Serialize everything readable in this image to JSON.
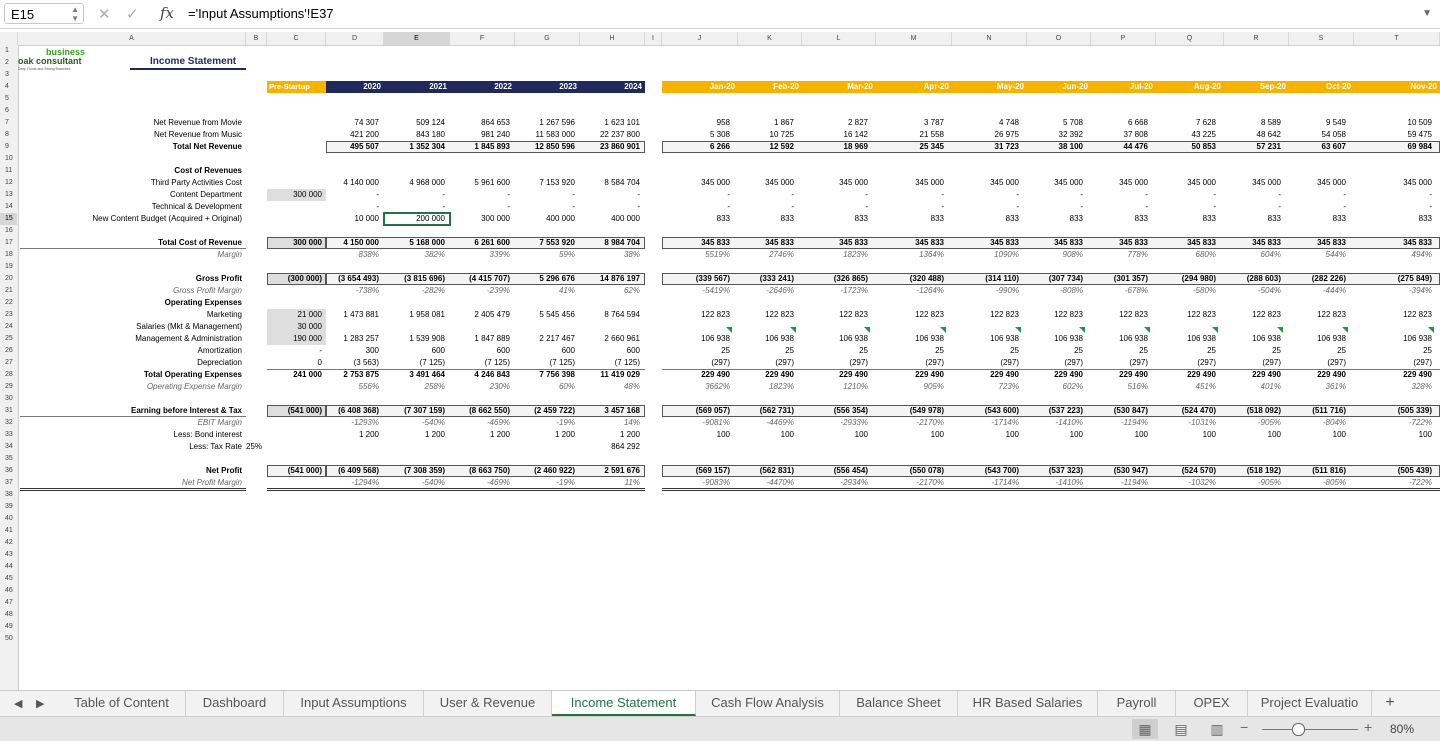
{
  "formula_bar": {
    "cell_ref": "E15",
    "formula": "='Input Assumptions'!E37",
    "fx": "fx"
  },
  "columns": [
    "A",
    "B",
    "C",
    "D",
    "E",
    "F",
    "G",
    "H",
    "I",
    "J",
    "K",
    "L",
    "M",
    "N",
    "O",
    "P",
    "Q",
    "R",
    "S",
    "T"
  ],
  "selected_column": "E",
  "selected_row": "15",
  "rows": [
    "1",
    "2",
    "3",
    "4",
    "5",
    "6",
    "7",
    "8",
    "9",
    "10",
    "11",
    "12",
    "13",
    "14",
    "15",
    "16",
    "17",
    "18",
    "19",
    "20",
    "21",
    "22",
    "23",
    "24",
    "25",
    "26",
    "27",
    "28",
    "29",
    "30",
    "31",
    "32",
    "33",
    "34",
    "35",
    "36",
    "37",
    "38",
    "39",
    "40",
    "41",
    "42",
    "43",
    "44",
    "45",
    "46",
    "47",
    "48",
    "49",
    "50"
  ],
  "logo": {
    "text_top": "business",
    "text_mid": "oak consultant",
    "tagline": "Deep Roots and Strong Branches"
  },
  "title": "Income Statement",
  "header": {
    "pre": "Pre-Startup",
    "years": [
      "2020",
      "2021",
      "2022",
      "2023",
      "2024"
    ],
    "months": [
      "Jan-20",
      "Feb-20",
      "Mar-20",
      "Apr-20",
      "May-20",
      "Jun-20",
      "Jul-20",
      "Aug-20",
      "Sep-20",
      "Oct-20",
      "Nov-20"
    ]
  },
  "lines": [
    {
      "row": 7,
      "label": "Net Revenue from Movie",
      "pre": "",
      "years": [
        "74 307",
        "509 124",
        "864 653",
        "1 267 596",
        "1 623 101"
      ],
      "months": [
        "958",
        "1 867",
        "2 827",
        "3 787",
        "4 748",
        "5 708",
        "6 668",
        "7 628",
        "8 589",
        "9 549",
        "10 509"
      ]
    },
    {
      "row": 8,
      "label": "Net Revenue from Music",
      "pre": "",
      "years": [
        "421 200",
        "843 180",
        "981 240",
        "11 583 000",
        "22 237 800"
      ],
      "months": [
        "5 308",
        "10 725",
        "16 142",
        "21 558",
        "26 975",
        "32 392",
        "37 808",
        "43 225",
        "48 642",
        "54 058",
        "59 475"
      ]
    },
    {
      "row": 9,
      "label": "Total Net Revenue",
      "bold": true,
      "box": true,
      "pre": "",
      "years": [
        "495 507",
        "1 352 304",
        "1 845 893",
        "12 850 596",
        "23 860 901"
      ],
      "months": [
        "6 266",
        "12 592",
        "18 969",
        "25 345",
        "31 723",
        "38 100",
        "44 476",
        "50 853",
        "57 231",
        "63 607",
        "69 984"
      ]
    },
    {
      "row": 11,
      "label": "Cost of Revenues",
      "bold": true,
      "pre": "",
      "years": [
        "",
        "",
        "",
        "",
        ""
      ],
      "months": [
        "",
        "",
        "",
        "",
        "",
        "",
        "",
        "",
        "",
        "",
        ""
      ]
    },
    {
      "row": 12,
      "label": "Third Party Activities Cost",
      "pre": "",
      "years": [
        "4 140 000",
        "4 968 000",
        "5 961 600",
        "7 153 920",
        "8 584 704"
      ],
      "months": [
        "345 000",
        "345 000",
        "345 000",
        "345 000",
        "345 000",
        "345 000",
        "345 000",
        "345 000",
        "345 000",
        "345 000",
        "345 000"
      ]
    },
    {
      "row": 13,
      "label": "Content Department",
      "pre": "300 000",
      "preshade": true,
      "years": [
        "-",
        "-",
        "-",
        "-",
        "-"
      ],
      "months": [
        "-",
        "-",
        "-",
        "-",
        "-",
        "-",
        "-",
        "-",
        "-",
        "-",
        "-"
      ]
    },
    {
      "row": 14,
      "label": "Technical & Development",
      "pre": "",
      "years": [
        "-",
        "-",
        "-",
        "-",
        "-"
      ],
      "months": [
        "-",
        "-",
        "-",
        "-",
        "-",
        "-",
        "-",
        "-",
        "-",
        "-",
        "-"
      ]
    },
    {
      "row": 15,
      "label": "New Content Budget (Acquired + Original)",
      "pre": "",
      "years": [
        "10 000",
        "200 000",
        "300 000",
        "400 000",
        "400 000"
      ],
      "months": [
        "833",
        "833",
        "833",
        "833",
        "833",
        "833",
        "833",
        "833",
        "833",
        "833",
        "833"
      ]
    },
    {
      "row": 17,
      "label": "Total Cost of Revenue",
      "bold": true,
      "box": true,
      "pre": "300 000",
      "preshade": true,
      "years": [
        "4 150 000",
        "5 168 000",
        "6 261 600",
        "7 553 920",
        "8 984 704"
      ],
      "months": [
        "345 833",
        "345 833",
        "345 833",
        "345 833",
        "345 833",
        "345 833",
        "345 833",
        "345 833",
        "345 833",
        "345 833",
        "345 833"
      ]
    },
    {
      "row": 18,
      "label": "Margin",
      "italic": true,
      "pre": "",
      "years": [
        "838%",
        "382%",
        "339%",
        "59%",
        "38%"
      ],
      "months": [
        "5519%",
        "2746%",
        "1823%",
        "1364%",
        "1090%",
        "908%",
        "778%",
        "680%",
        "604%",
        "544%",
        "494%"
      ]
    },
    {
      "row": 20,
      "label": "Gross Profit",
      "bold": true,
      "box": true,
      "pre": "(300 000)",
      "preshade": true,
      "years": [
        "(3 654 493)",
        "(3 815 696)",
        "(4 415 707)",
        "5 296 676",
        "14 876 197"
      ],
      "months": [
        "(339 567)",
        "(333 241)",
        "(326 865)",
        "(320 488)",
        "(314 110)",
        "(307 734)",
        "(301 357)",
        "(294 980)",
        "(288 603)",
        "(282 226)",
        "(275 849)"
      ]
    },
    {
      "row": 21,
      "label": "Gross Profit Margin",
      "italic": true,
      "pre": "",
      "years": [
        "-738%",
        "-282%",
        "-239%",
        "41%",
        "62%"
      ],
      "months": [
        "-5419%",
        "-2646%",
        "-1723%",
        "-1264%",
        "-990%",
        "-808%",
        "-678%",
        "-580%",
        "-504%",
        "-444%",
        "-394%"
      ]
    },
    {
      "row": 22,
      "label": "Operating Expenses",
      "bold": true,
      "pre": "",
      "years": [
        "",
        "",
        "",
        "",
        ""
      ],
      "months": [
        "",
        "",
        "",
        "",
        "",
        "",
        "",
        "",
        "",
        "",
        ""
      ]
    },
    {
      "row": 23,
      "label": "Marketing",
      "pre": "21 000",
      "preshade": true,
      "years": [
        "1 473 881",
        "1 958 081",
        "2 405 479",
        "5 545 456",
        "8 764 594"
      ],
      "months": [
        "122 823",
        "122 823",
        "122 823",
        "122 823",
        "122 823",
        "122 823",
        "122 823",
        "122 823",
        "122 823",
        "122 823",
        "122 823"
      ]
    },
    {
      "row": 24,
      "label": "Salaries (Mkt & Management)",
      "pre": "30 000",
      "preshade": true,
      "years": [
        "",
        "",
        "",
        "",
        ""
      ],
      "months": [
        "",
        "",
        "",
        "",
        "",
        "",
        "",
        "",
        "",
        "",
        ""
      ]
    },
    {
      "row": 25,
      "label": "Management & Administration",
      "pre": "190 000",
      "preshade": true,
      "tri": true,
      "years": [
        "1 283 257",
        "1 539 908",
        "1 847 889",
        "2 217 467",
        "2 660 961"
      ],
      "months": [
        "106 938",
        "106 938",
        "106 938",
        "106 938",
        "106 938",
        "106 938",
        "106 938",
        "106 938",
        "106 938",
        "106 938",
        "106 938"
      ]
    },
    {
      "row": 26,
      "label": "Amortization",
      "pre": "-",
      "years": [
        "300",
        "600",
        "600",
        "600",
        "600"
      ],
      "months": [
        "25",
        "25",
        "25",
        "25",
        "25",
        "25",
        "25",
        "25",
        "25",
        "25",
        "25"
      ]
    },
    {
      "row": 27,
      "label": "Depreciation",
      "pre": "0",
      "years": [
        "(3 563)",
        "(7 125)",
        "(7 125)",
        "(7 125)",
        "(7 125)"
      ],
      "months": [
        "(297)",
        "(297)",
        "(297)",
        "(297)",
        "(297)",
        "(297)",
        "(297)",
        "(297)",
        "(297)",
        "(297)",
        "(297)"
      ]
    },
    {
      "row": 28,
      "label": "Total Operating Expenses",
      "bold": true,
      "pre": "241 000",
      "years": [
        "2 753 875",
        "3 491 464",
        "4 246 843",
        "7 756 398",
        "11 419 029"
      ],
      "months": [
        "229 490",
        "229 490",
        "229 490",
        "229 490",
        "229 490",
        "229 490",
        "229 490",
        "229 490",
        "229 490",
        "229 490",
        "229 490"
      ]
    },
    {
      "row": 29,
      "label": "Operating Expense Margin",
      "italic": true,
      "pre": "",
      "years": [
        "556%",
        "258%",
        "230%",
        "60%",
        "48%"
      ],
      "months": [
        "3662%",
        "1823%",
        "1210%",
        "905%",
        "723%",
        "602%",
        "516%",
        "451%",
        "401%",
        "361%",
        "328%"
      ]
    },
    {
      "row": 31,
      "label": "Earning before Interest & Tax",
      "bold": true,
      "box": true,
      "pre": "(541 000)",
      "preshade": true,
      "years": [
        "(6 408 368)",
        "(7 307 159)",
        "(8 662 550)",
        "(2 459 722)",
        "3 457 168"
      ],
      "months": [
        "(569 057)",
        "(562 731)",
        "(556 354)",
        "(549 978)",
        "(543 600)",
        "(537 223)",
        "(530 847)",
        "(524 470)",
        "(518 092)",
        "(511 716)",
        "(505 339)"
      ]
    },
    {
      "row": 32,
      "label": "EBIT Margin",
      "italic": true,
      "pre": "",
      "years": [
        "-1293%",
        "-540%",
        "-469%",
        "-19%",
        "14%"
      ],
      "months": [
        "-9081%",
        "-4469%",
        "-2933%",
        "-2170%",
        "-1714%",
        "-1410%",
        "-1194%",
        "-1031%",
        "-905%",
        "-804%",
        "-722%"
      ]
    },
    {
      "row": 33,
      "label": "Less: Bond interest",
      "pre": "",
      "years": [
        "1 200",
        "1 200",
        "1 200",
        "1 200",
        "1 200"
      ],
      "months": [
        "100",
        "100",
        "100",
        "100",
        "100",
        "100",
        "100",
        "100",
        "100",
        "100",
        "100"
      ]
    },
    {
      "row": 34,
      "label": "Less: Tax Rate",
      "extra": "25%",
      "pre": "",
      "years": [
        "",
        "",
        "",
        "",
        "864 292"
      ],
      "months": [
        "",
        "",
        "",
        "",
        "",
        "",
        "",
        "",
        "",
        "",
        ""
      ]
    },
    {
      "row": 36,
      "label": "Net Profit",
      "bold": true,
      "box": true,
      "pre": "(541 000)",
      "years": [
        "(6 409 568)",
        "(7 308 359)",
        "(8 663 750)",
        "(2 460 922)",
        "2 591 676"
      ],
      "months": [
        "(569 157)",
        "(562 831)",
        "(556 454)",
        "(550 078)",
        "(543 700)",
        "(537 323)",
        "(530 947)",
        "(524 570)",
        "(518 192)",
        "(511 816)",
        "(505 439)"
      ]
    },
    {
      "row": 37,
      "label": "Net Profit Margin",
      "italic": true,
      "pre": "",
      "years": [
        "-1294%",
        "-540%",
        "-469%",
        "-19%",
        "11%"
      ],
      "months": [
        "-9083%",
        "-4470%",
        "-2934%",
        "-2170%",
        "-1714%",
        "-1410%",
        "-1194%",
        "-1032%",
        "-905%",
        "-805%",
        "-722%"
      ]
    }
  ],
  "tabs": [
    "Table of Content",
    "Dashboard",
    "Input Assumptions",
    "User & Revenue",
    "Income Statement",
    "Cash Flow Analysis",
    "Balance Sheet",
    "HR Based Salaries",
    "Payroll",
    "OPEX",
    "Project Evaluatio"
  ],
  "active_tab": "Income Statement",
  "add_sheet": "+",
  "zoom": "80%",
  "colors": {
    "navy": "#1f2a5a",
    "orange": "#f5b300",
    "excel_green": "#217346",
    "marker_green": "#1a9c3a"
  }
}
